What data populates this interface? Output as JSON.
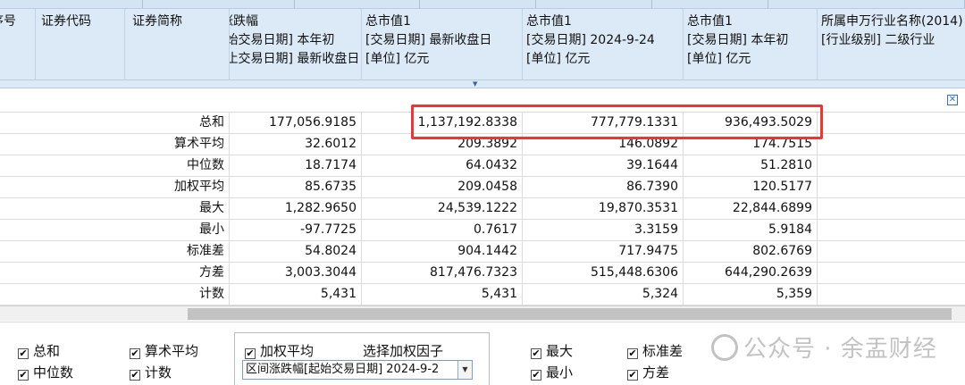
{
  "header": {
    "seq_label": "序号",
    "code_label": "证券代码",
    "name_label": "证券简称",
    "chg": {
      "line1": "区间涨跌幅",
      "line2": "[起始交易日期] 本年初",
      "line3": "[截止交易日期] 最新收盘日"
    },
    "mv1": {
      "line1": "总市值1",
      "line2": "[交易日期] 最新收盘日",
      "line3": "[单位] 亿元"
    },
    "mv2": {
      "line1": "总市值1",
      "line2": "[交易日期] 2024-9-24",
      "line3": "[单位] 亿元"
    },
    "mv3": {
      "line1": "总市值1",
      "line2": "[交易日期] 本年初",
      "line3": "[单位] 亿元"
    },
    "ind": {
      "line1": "所属申万行业名称(2014)",
      "line2": "[行业级别] 二级行业"
    }
  },
  "rows": [
    {
      "label": "总和",
      "chg": "177,056.9185",
      "mv1": "1,137,192.8338",
      "mv2": "777,779.1331",
      "mv3": "936,493.5029"
    },
    {
      "label": "算术平均",
      "chg": "32.6012",
      "mv1": "209.3892",
      "mv2": "146.0892",
      "mv3": "174.7515"
    },
    {
      "label": "中位数",
      "chg": "18.7174",
      "mv1": "64.0432",
      "mv2": "39.1644",
      "mv3": "51.2810"
    },
    {
      "label": "加权平均",
      "chg": "85.6735",
      "mv1": "209.0458",
      "mv2": "86.7390",
      "mv3": "120.5177"
    },
    {
      "label": "最大",
      "chg": "1,282.9650",
      "mv1": "24,539.1222",
      "mv2": "19,870.3531",
      "mv3": "22,844.6899"
    },
    {
      "label": "最小",
      "chg": "-97.7725",
      "mv1": "0.7617",
      "mv2": "3.3159",
      "mv3": "5.9184"
    },
    {
      "label": "标准差",
      "chg": "54.8024",
      "mv1": "904.1442",
      "mv2": "717.9475",
      "mv3": "802.6769"
    },
    {
      "label": "方差",
      "chg": "3,003.3044",
      "mv1": "817,476.7323",
      "mv2": "515,448.6306",
      "mv3": "644,290.2639"
    },
    {
      "label": "计数",
      "chg": "5,431",
      "mv1": "5,431",
      "mv2": "5,324",
      "mv3": "5,359"
    }
  ],
  "options": {
    "sum": "总和",
    "mean": "算术平均",
    "median": "中位数",
    "count": "计数",
    "weighted_mean": "加权平均",
    "choose_weight": "选择加权因子",
    "weight_factor_value": "区间涨跌幅[起始交易日期] 2024-9-2",
    "max": "最大",
    "min": "最小",
    "std": "标准差",
    "variance": "方差",
    "check_mark": "✔"
  },
  "watermark": "公众号 · 余盂财经",
  "colors": {
    "highlight": "#e53935",
    "header_bg": "#dce9f6"
  }
}
